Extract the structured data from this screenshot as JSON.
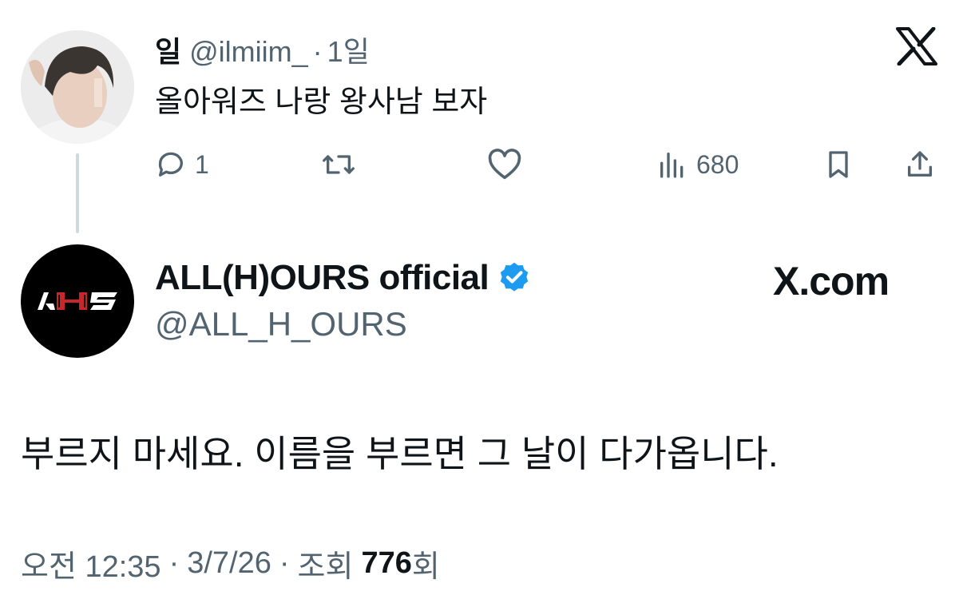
{
  "reply": {
    "display_name": "일",
    "handle": "@ilmiim_",
    "separator": "·",
    "time": "1일",
    "text": "올아워즈 나랑 왕사남 보자",
    "avatar_icon": "user-photo-avatar",
    "actions": {
      "reply_count": "1",
      "retweet_count": "",
      "like_count": "",
      "views_count": "680"
    }
  },
  "quoted": {
    "display_name": "ALL(H)OURS official",
    "handle": "@ALL_H_OURS",
    "avatar_logo": "AHS",
    "verified_color": "#1d9bf0",
    "text": "부르지 마세요. 이름을 부르면 그 날이 다가옵니다.",
    "site": "X.com"
  },
  "meta": {
    "time": "오전 12:35",
    "sep": "·",
    "date": "3/7/26",
    "views_label": "조회",
    "views_count": "776",
    "views_suffix": "회"
  },
  "colors": {
    "text": "#0f1419",
    "secondary": "#536471",
    "thread_line": "#cfd9de",
    "accent_red": "#c8262b"
  }
}
